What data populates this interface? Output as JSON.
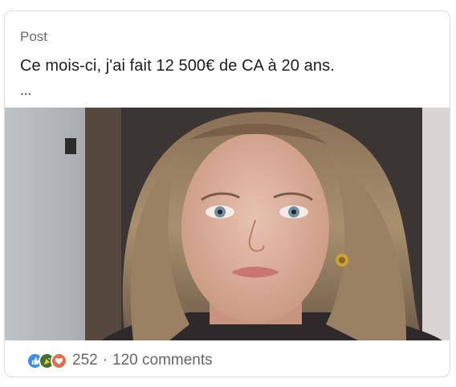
{
  "post": {
    "label": "Post",
    "text": "Ce mois-ci, j'ai fait 12 500€ de CA à 20 ans.",
    "more": "..."
  },
  "image": {
    "description_icon": "portrait-photo"
  },
  "social": {
    "reaction_icons": [
      "like-icon",
      "celebrate-icon",
      "love-icon"
    ],
    "reaction_colors": {
      "like": "#378fe9",
      "celebrate": "#44712e",
      "love": "#df704d"
    },
    "reaction_count": "252",
    "separator": "·",
    "comments": "120 comments"
  }
}
